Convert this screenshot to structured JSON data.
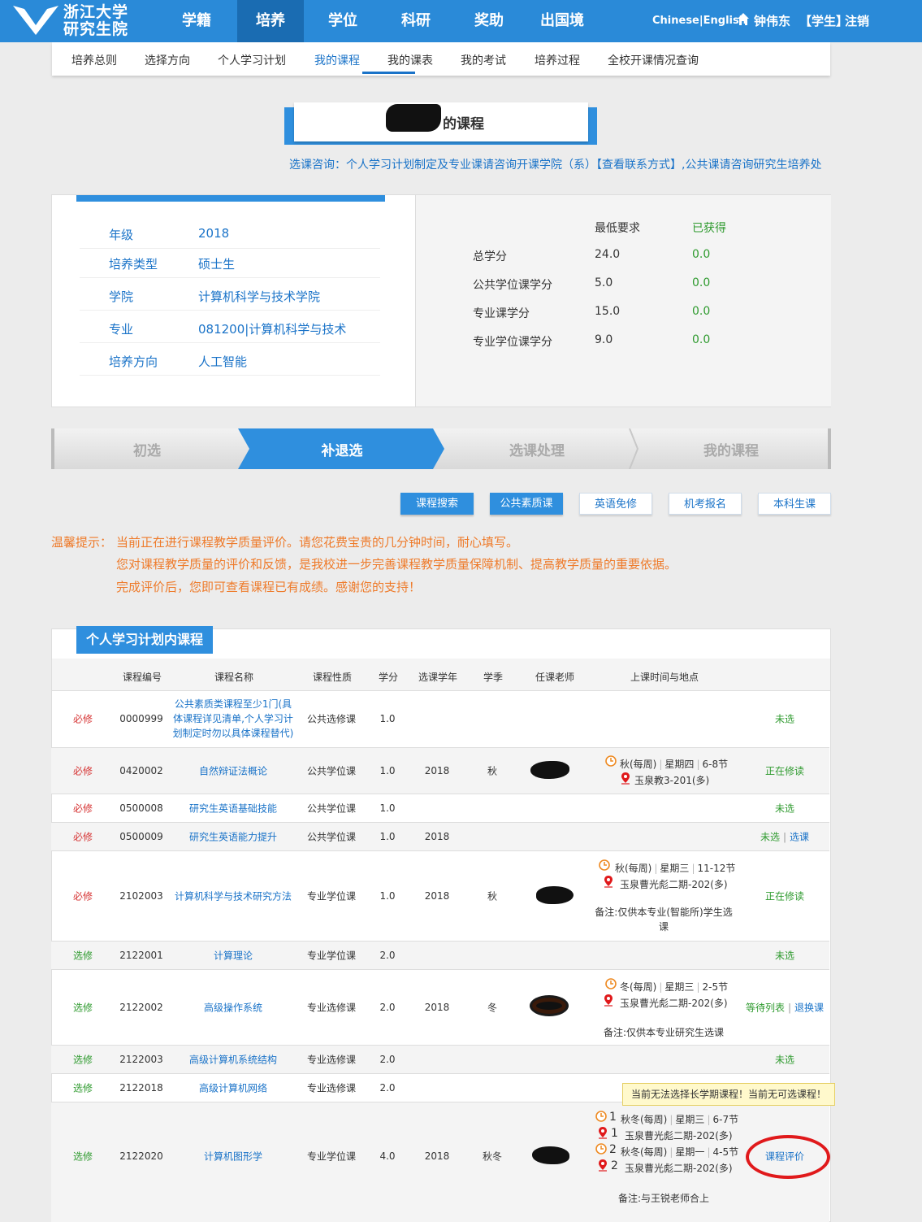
{
  "logo": {
    "line1": "浙江大学",
    "line2": "研究生院"
  },
  "nav": [
    "学籍",
    "培养",
    "学位",
    "科研",
    "奖助",
    "出国境"
  ],
  "lang": "Chinese|English",
  "user": {
    "name": "钟伟东",
    "role": "【学生】",
    "logout": "注销"
  },
  "subnav": [
    "培养总则",
    "选择方向",
    "个人学习计划",
    "我的课程",
    "我的课表",
    "我的考试",
    "培养过程",
    "全校开课情况查询"
  ],
  "title": "的课程",
  "consult": "选课咨询：个人学习计划制定及专业课请咨询开课学院（系）【查看联系方式】,公共课请咨询研究生培养处",
  "info": [
    {
      "label": "年级",
      "value": "2018"
    },
    {
      "label": "培养类型",
      "value": "硕士生"
    },
    {
      "label": "学院",
      "value": "计算机科学与技术学院"
    },
    {
      "label": "专业",
      "value": "081200|计算机科学与技术"
    },
    {
      "label": "培养方向",
      "value": "人工智能"
    }
  ],
  "credits": {
    "head_min": "最低要求",
    "head_got": "已获得",
    "rows": [
      {
        "label": "总学分",
        "min": "24.0",
        "got": "0.0"
      },
      {
        "label": "公共学位课学分",
        "min": "5.0",
        "got": "0.0"
      },
      {
        "label": "专业课学分",
        "min": "15.0",
        "got": "0.0"
      },
      {
        "label": "专业学位课学分",
        "min": "9.0",
        "got": "0.0"
      }
    ]
  },
  "steps": [
    "初选",
    "补退选",
    "选课处理",
    "我的课程"
  ],
  "actions": [
    "课程搜索",
    "公共素质课",
    "英语免修",
    "机考报名",
    "本科生课"
  ],
  "notice": {
    "prefix": "温馨提示：",
    "line1": "当前正在进行课程教学质量评价。请您花费宝贵的几分钟时间，耐心填写。",
    "line2": "您对课程教学质量的评价和反馈，是我校进一步完善课程教学质量保障机制、提高教学质量的重要依据。",
    "line3": "完成评价后，您即可查看课程已有成绩。感谢您的支持！"
  },
  "table": {
    "tab": "个人学习计划内课程",
    "headers": [
      "课程编号",
      "课程名称",
      "课程性质",
      "学分",
      "选课学年",
      "学季",
      "任课老师",
      "上课时间与地点"
    ],
    "rows": [
      {
        "type": "必修",
        "code": "0000999",
        "name": "公共素质类课程至少1门(具体课程详见清单,个人学习计划制定时勿以具体课程替代)",
        "nature": "公共选修课",
        "credit": "1.0",
        "year": "",
        "term": "",
        "status": "未选"
      },
      {
        "type": "必修",
        "code": "0420002",
        "name": "自然辩证法概论",
        "nature": "公共学位课",
        "credit": "1.0",
        "year": "2018",
        "term": "秋",
        "time": "秋(每周)",
        "day": "星期四",
        "period": "6-8节",
        "place": "玉泉教3-201(多)",
        "status": "正在修读"
      },
      {
        "type": "必修",
        "code": "0500008",
        "name": "研究生英语基础技能",
        "nature": "公共学位课",
        "credit": "1.0",
        "year": "",
        "term": "",
        "status": "未选"
      },
      {
        "type": "必修",
        "code": "0500009",
        "name": "研究生英语能力提升",
        "nature": "公共学位课",
        "credit": "1.0",
        "year": "2018",
        "term": "",
        "status": "未选",
        "status2": "选课"
      },
      {
        "type": "必修",
        "code": "2102003",
        "name": "计算机科学与技术研究方法",
        "nature": "专业学位课",
        "credit": "1.0",
        "year": "2018",
        "term": "秋",
        "time": "秋(每周)",
        "day": "星期三",
        "period": "11-12节",
        "place": "玉泉曹光彪二期-202(多)",
        "note": "备注:仅供本专业(智能所)学生选课",
        "status": "正在修读"
      },
      {
        "type": "选修",
        "code": "2122001",
        "name": "计算理论",
        "nature": "专业学位课",
        "credit": "2.0",
        "year": "",
        "term": "",
        "status": "未选"
      },
      {
        "type": "选修",
        "code": "2122002",
        "name": "高级操作系统",
        "nature": "专业选修课",
        "credit": "2.0",
        "year": "2018",
        "term": "冬",
        "time": "冬(每周)",
        "day": "星期三",
        "period": "2-5节",
        "place": "玉泉曹光彪二期-202(多)",
        "note": "备注:仅供本专业研究生选课",
        "status": "等待列表",
        "status2": "退换课"
      },
      {
        "type": "选修",
        "code": "2122003",
        "name": "高级计算机系统结构",
        "nature": "专业选修课",
        "credit": "2.0",
        "year": "",
        "term": "",
        "status": "未选"
      },
      {
        "type": "选修",
        "code": "2122018",
        "name": "高级计算机网络",
        "nature": "专业选修课",
        "credit": "2.0",
        "year": "",
        "term": "",
        "status": ""
      },
      {
        "type": "选修",
        "code": "2122020",
        "name": "计算机图形学",
        "nature": "专业学位课",
        "credit": "4.0",
        "year": "2018",
        "term": "秋冬",
        "sched": [
          {
            "n": "1",
            "time": "秋冬(每周)",
            "day": "星期三",
            "period": "6-7节",
            "place": "玉泉曹光彪二期-202(多)"
          },
          {
            "n": "2",
            "time": "秋冬(每周)",
            "day": "星期一",
            "period": "4-5节",
            "place": "玉泉曹光彪二期-202(多)"
          }
        ],
        "note": "备注:与王锐老师合上",
        "status": "课程评价"
      }
    ]
  },
  "tooltip": "当前无法选择长学期课程！当前无可选课程！",
  "colors": {
    "primary": "#2a8ad8",
    "dark": "#1a6cb2",
    "link": "#1a73c8",
    "required": "#d63232",
    "elective": "#2e9a2e",
    "notice": "#ee7b2b",
    "annotation": "#e0191b"
  }
}
